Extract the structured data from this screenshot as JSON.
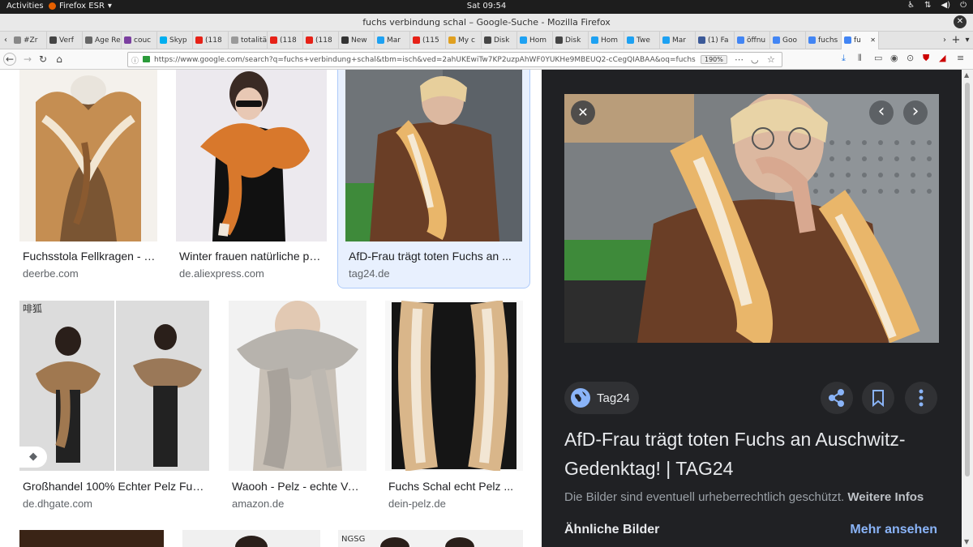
{
  "system": {
    "activities": "Activities",
    "app_menu": "Firefox ESR",
    "clock": "Sat 09:54"
  },
  "window": {
    "title": "fuchs verbindung schal – Google-Suche - Mozilla Firefox"
  },
  "tabs": [
    {
      "label": "#Zr",
      "color": "#888888"
    },
    {
      "label": "Verf",
      "color": "#444444"
    },
    {
      "label": "Age Red",
      "color": "#666666"
    },
    {
      "label": "couc",
      "color": "#7b3fa0"
    },
    {
      "label": "Skyp",
      "color": "#00aff0"
    },
    {
      "label": "(118",
      "color": "#e62117"
    },
    {
      "label": "totalitär",
      "color": "#999999"
    },
    {
      "label": "(118",
      "color": "#e62117"
    },
    {
      "label": "(118",
      "color": "#e62117"
    },
    {
      "label": "New",
      "color": "#333333"
    },
    {
      "label": "Mar",
      "color": "#1da1f2"
    },
    {
      "label": "(115",
      "color": "#e62117"
    },
    {
      "label": "My c",
      "color": "#e0a020"
    },
    {
      "label": "Disk",
      "color": "#444444"
    },
    {
      "label": "Hom",
      "color": "#1da1f2"
    },
    {
      "label": "Disk",
      "color": "#444444"
    },
    {
      "label": "Hom",
      "color": "#1da1f2"
    },
    {
      "label": "Twe",
      "color": "#1da1f2"
    },
    {
      "label": "Mar",
      "color": "#1da1f2"
    },
    {
      "label": "(1) Fa",
      "color": "#3b5998"
    },
    {
      "label": "öffnu",
      "color": "#4285f4"
    },
    {
      "label": "Goo",
      "color": "#4285f4"
    },
    {
      "label": "fuchs",
      "color": "#4285f4"
    },
    {
      "label": "fu",
      "color": "#4285f4",
      "active": true
    }
  ],
  "nav": {
    "url": "https://www.google.com/search?q=fuchs+verbindung+schal&tbm=isch&ved=2ahUKEwiTw7KP2uzpAhWF0YUKHe9MBEUQ2-cCegQIABAA&oq=fuchs+verbin",
    "zoom": "190%",
    "icons": [
      "back-icon",
      "forward-icon",
      "reload-icon",
      "home-icon",
      "download-icon",
      "library-icon",
      "sidebar-icon",
      "account-icon",
      "ublock-icon",
      "extension-icon",
      "menu-icon"
    ]
  },
  "results": [
    {
      "title": "Fuchsstola Fellkragen - Pelz ...",
      "source": "deerbe.com"
    },
    {
      "title": "Winter frauen natürliche pelz ...",
      "source": "de.aliexpress.com"
    },
    {
      "title": "AfD-Frau trägt toten Fuchs an ...",
      "source": "tag24.de",
      "selected": true
    },
    {
      "title": "Großhandel 100% Echter Pelz Fuchs ...",
      "source": "de.dhgate.com",
      "badge": "tag-icon"
    },
    {
      "title": "Waooh - Pelz - echte Vollfell ...",
      "source": "amazon.de"
    },
    {
      "title": "Fuchs Schal echt Pelz ...",
      "source": "dein-pelz.de"
    }
  ],
  "panel": {
    "source_name": "Tag24",
    "title": "AfD-Frau trägt toten Fuchs an Auschwitz-Gedenktag! | TAG24",
    "copyright_text": "Die Bilder sind eventuell urheberrechtlich geschützt.",
    "more_info": "Weitere Infos",
    "similar_heading": "Ähnliche Bilder",
    "see_more": "Mehr ansehen",
    "close_glyph": "✕",
    "prev_glyph": "‹",
    "next_glyph": "›"
  },
  "colors": {
    "panel_bg": "#202124",
    "link_blue": "#8ab4f8",
    "selection_bg": "#e8f0fe"
  }
}
